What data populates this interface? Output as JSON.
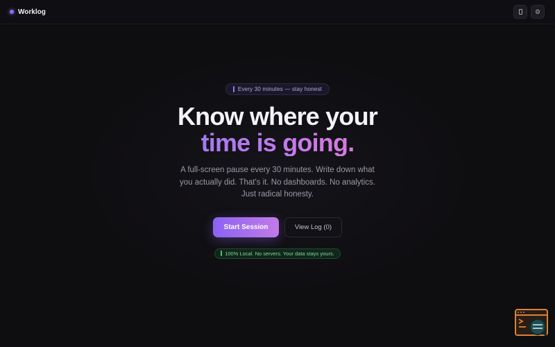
{
  "header": {
    "brand": "Worklog",
    "actions": [
      {
        "icon": "phone-icon"
      },
      {
        "icon": "gear-icon",
        "glyph": "⚙"
      }
    ]
  },
  "hero": {
    "pill_text": "Every 30 minutes — stay honest",
    "headline_line1": "Know where your",
    "headline_line2": "time is going.",
    "subtitle": "A full-screen pause every 30 minutes. Write down what you actually did. That's it. No dashboards. No analytics. Just radical honesty.",
    "primary_button": "Start Session",
    "secondary_button": "View Log (0)",
    "local_badge": "100% Local. No servers. Your data stays yours."
  },
  "colors": {
    "accent": "#8b6cf6",
    "gradient_end": "#e07ad9",
    "success": "#46c97a",
    "background": "#0e0d10"
  }
}
